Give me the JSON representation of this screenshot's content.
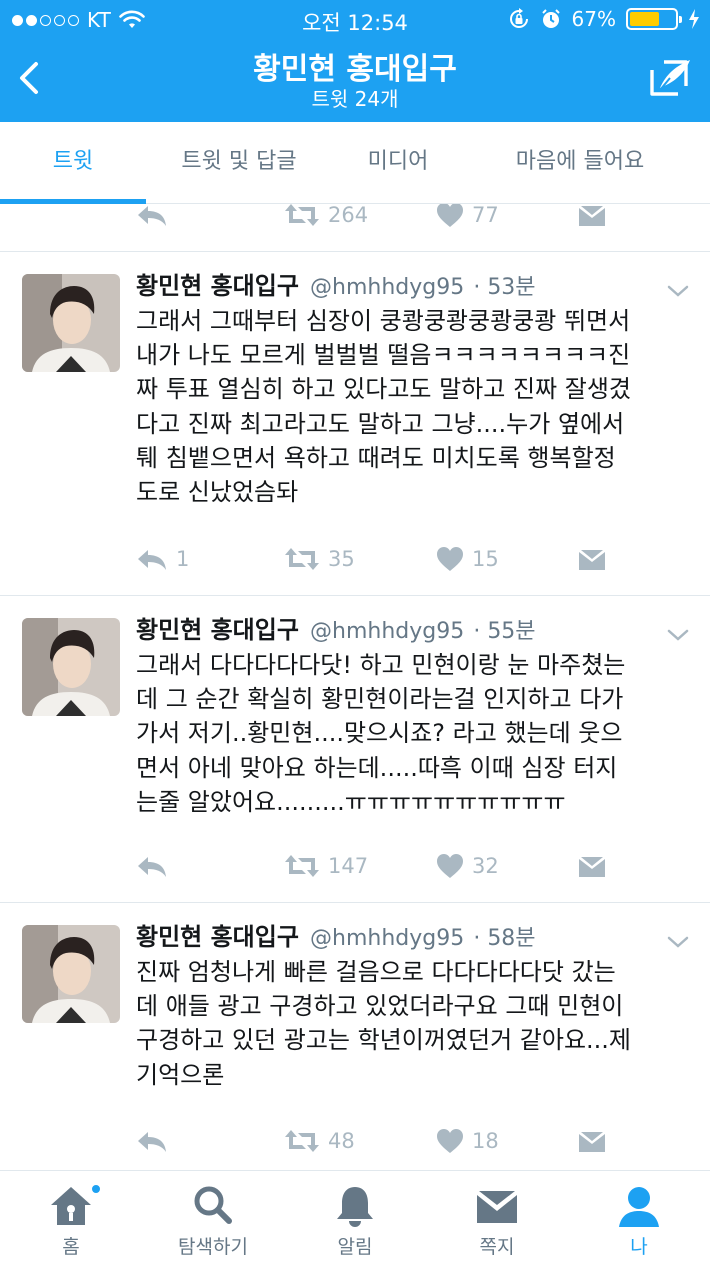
{
  "status_bar": {
    "carrier": "KT",
    "time": "오전 12:54",
    "battery": "67%",
    "battery_level": 0.67,
    "signal_bars": 2
  },
  "nav": {
    "title": "황민현 홍대입구",
    "subtitle": "트윗 24개"
  },
  "tabs": [
    {
      "label": "트윗",
      "active": true
    },
    {
      "label": "트윗 및 답글",
      "active": false
    },
    {
      "label": "미디어",
      "active": false
    },
    {
      "label": "마음에 들어요",
      "active": false
    }
  ],
  "previous_tweet_actions": {
    "reply": "",
    "retweets": "264",
    "likes": "77"
  },
  "tweets": [
    {
      "name": "황민현 홍대입구",
      "handle": "@hmhhdyg95",
      "time": "· 53분",
      "text": "그래서 그때부터 심장이 쿵쾅쿵쾅쿵쾅쿵쾅 뛰면서\n내가 나도 모르게 벌벌벌 떨음ㅋㅋㅋㅋㅋㅋㅋㅋ진\n짜 투표 열심히 하고 있다고도 말하고 진짜 잘생겼\n다고 진짜 최고라고도 말하고 그냥....누가 옆에서\n퉤 침뱉으면서 욕하고 때려도 미치도록 행복할정\n도로 신났었슴돠",
      "replies": "1",
      "retweets": "35",
      "likes": "15"
    },
    {
      "name": "황민현 홍대입구",
      "handle": "@hmhhdyg95",
      "time": "· 55분",
      "text": "그래서 다다다다다닷! 하고 민현이랑 눈 마주쳤는\n데 그 순간 확실히 황민현이라는걸 인지하고 다가\n가서 저기..황민현....맞으시죠? 라고 했는데 웃으\n면서 아네 맞아요 하는데.....따흑 이때 심장 터지\n는줄 알았어요.........ㅠㅠㅠㅠㅠㅠㅠㅠㅠㅠ",
      "replies": "",
      "retweets": "147",
      "likes": "32"
    },
    {
      "name": "황민현 홍대입구",
      "handle": "@hmhhdyg95",
      "time": "· 58분",
      "text": "진짜 엄청나게 빠른 걸음으로 다다다다다닷 갔는\n데 애들 광고 구경하고 있었더라구요 그때 민현이\n구경하고 있던 광고는 학년이꺼였던거 같아요...제\n기억으론",
      "replies": "",
      "retweets": "48",
      "likes": "18"
    }
  ],
  "tabbar": [
    {
      "label": "홈",
      "icon": "home-icon",
      "active": false,
      "badge": true
    },
    {
      "label": "탐색하기",
      "icon": "search-icon",
      "active": false,
      "badge": false
    },
    {
      "label": "알림",
      "icon": "bell-icon",
      "active": false,
      "badge": false
    },
    {
      "label": "쪽지",
      "icon": "envelope-icon",
      "active": false,
      "badge": false
    },
    {
      "label": "나",
      "icon": "profile-icon",
      "active": true,
      "badge": false
    }
  ],
  "colors": {
    "brand": "#1da1f2",
    "muted": "#657786",
    "action_gray": "#aab8c2",
    "battery": "#ffcc00"
  }
}
